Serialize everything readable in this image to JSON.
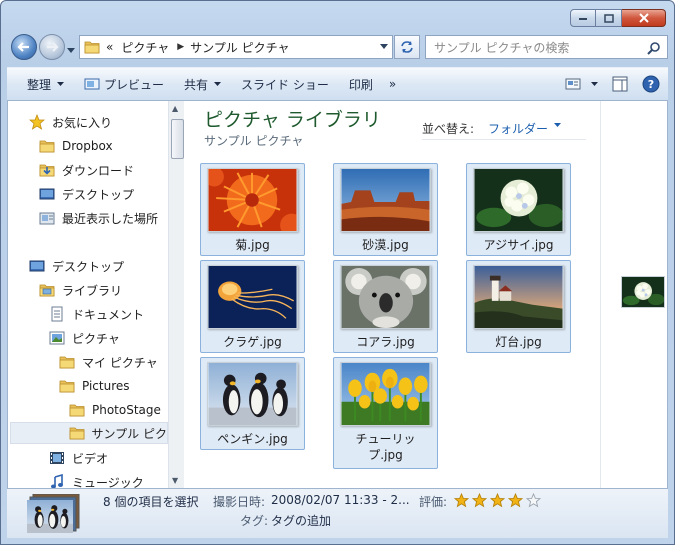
{
  "caption": {
    "minimize_label": "minimize",
    "maximize_label": "maximize",
    "close_label": "close"
  },
  "address": {
    "chevrons": "«",
    "crumbs": [
      "ピクチャ",
      "サンプル ピクチャ"
    ]
  },
  "search": {
    "placeholder": "サンプル ピクチャの検索"
  },
  "toolbar": {
    "organize": "整理",
    "preview": "プレビュー",
    "share": "共有",
    "slideshow": "スライド ショー",
    "print": "印刷",
    "more": "»"
  },
  "nav": {
    "favorites": "お気に入り",
    "dropbox": "Dropbox",
    "downloads": "ダウンロード",
    "desktop_fav": "デスクトップ",
    "recent": "最近表示した場所",
    "desktop": "デスクトップ",
    "libraries": "ライブラリ",
    "documents": "ドキュメント",
    "pictures": "ピクチャ",
    "my_pictures": "マイ ピクチャ",
    "pictures_en": "Pictures",
    "photostage": "PhotoStage",
    "sample_pictures": "サンプル ピク",
    "videos": "ビデオ",
    "music": "ミュージック"
  },
  "library": {
    "title": "ピクチャ ライブラリ",
    "subtitle": "サンプル ピクチャ",
    "sort_label": "並べ替え:",
    "sort_value": "フォルダー"
  },
  "files": [
    {
      "name": "菊.jpg",
      "img": "chrysanthemum"
    },
    {
      "name": "砂漠.jpg",
      "img": "desert"
    },
    {
      "name": "アジサイ.jpg",
      "img": "hydrangea"
    },
    {
      "name": "クラゲ.jpg",
      "img": "jellyfish"
    },
    {
      "name": "コアラ.jpg",
      "img": "koala"
    },
    {
      "name": "灯台.jpg",
      "img": "lighthouse"
    },
    {
      "name": "ペンギン.jpg",
      "img": "penguins"
    },
    {
      "name": "チューリップ.jpg",
      "img": "tulips"
    }
  ],
  "details": {
    "count": "8 個の項目を選択",
    "date_key": "撮影日時:",
    "date_value": "2008/02/07 11:33 - 2...",
    "rating_key": "評価:",
    "rating": 4,
    "rating_max": 5,
    "tags_key": "タグ:",
    "tags_value": "タグの追加"
  },
  "colors": {
    "library_title": "#1f5a2e",
    "link": "#1c5fae",
    "selection": "#dfeaf7",
    "star": "#f2b316"
  }
}
